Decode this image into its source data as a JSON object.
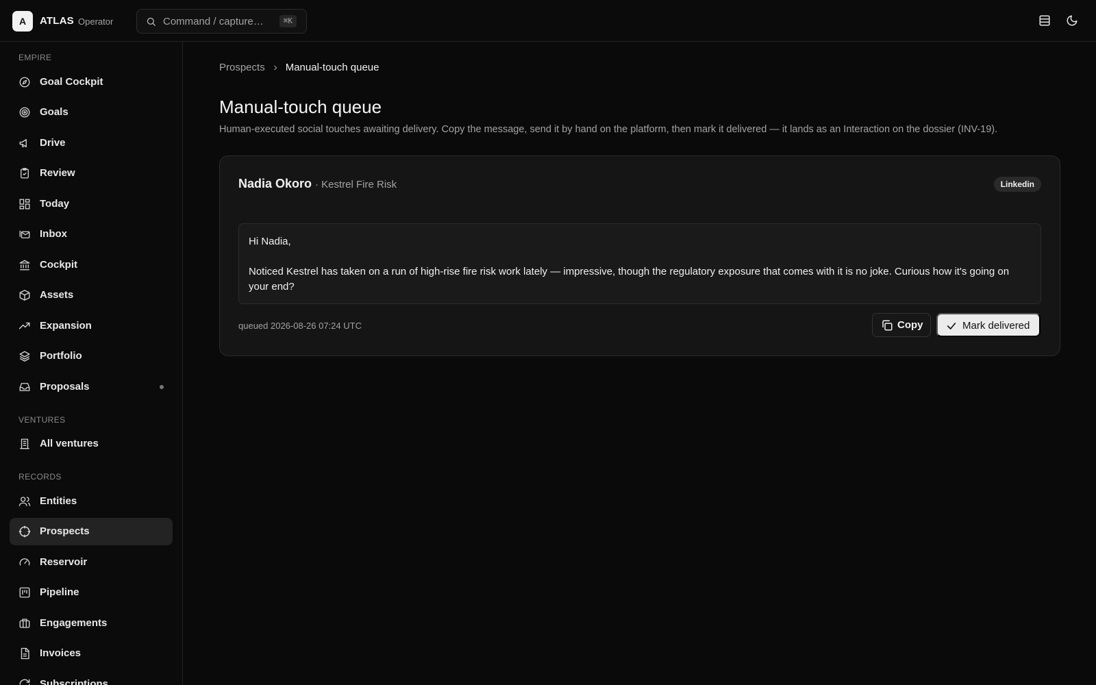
{
  "app": {
    "logo_letter": "A",
    "name": "ATLAS",
    "role": "Operator"
  },
  "search": {
    "placeholder": "Command / capture…",
    "shortcut": "⌘K"
  },
  "sidebar": {
    "sections": [
      {
        "label": "EMPIRE",
        "items": [
          {
            "label": "Goal Cockpit",
            "icon": "compass-icon"
          },
          {
            "label": "Goals",
            "icon": "target-icon"
          },
          {
            "label": "Drive",
            "icon": "megaphone-icon"
          },
          {
            "label": "Review",
            "icon": "clipboard-check-icon"
          },
          {
            "label": "Today",
            "icon": "dashboard-grid-icon"
          },
          {
            "label": "Inbox",
            "icon": "mail-stack-icon"
          },
          {
            "label": "Cockpit",
            "icon": "bank-icon"
          },
          {
            "label": "Assets",
            "icon": "cube-icon"
          },
          {
            "label": "Expansion",
            "icon": "trending-up-icon"
          },
          {
            "label": "Portfolio",
            "icon": "layers-icon"
          },
          {
            "label": "Proposals",
            "icon": "inbox-tray-icon"
          }
        ]
      },
      {
        "label": "VENTURES",
        "items": [
          {
            "label": "All ventures",
            "icon": "building-icon"
          }
        ]
      },
      {
        "label": "RECORDS",
        "items": [
          {
            "label": "Entities",
            "icon": "users-icon"
          },
          {
            "label": "Prospects",
            "icon": "crosshair-icon"
          },
          {
            "label": "Reservoir",
            "icon": "gauge-icon"
          },
          {
            "label": "Pipeline",
            "icon": "kanban-icon"
          },
          {
            "label": "Engagements",
            "icon": "briefcase-icon"
          },
          {
            "label": "Invoices",
            "icon": "file-text-icon"
          },
          {
            "label": "Subscriptions",
            "icon": "refresh-icon"
          }
        ]
      }
    ],
    "active_item": "Prospects"
  },
  "breadcrumb": {
    "parent": "Prospects",
    "current": "Manual-touch queue"
  },
  "page": {
    "title": "Manual-touch queue",
    "description": "Human-executed social touches awaiting delivery. Copy the message, send it by hand on the platform, then mark it delivered — it lands as an Interaction on the dossier (INV-19)."
  },
  "queue": [
    {
      "name": "Nadia Okoro",
      "company": "· Kestrel Fire Risk",
      "platform": "Linkedin",
      "message_lines": [
        "Hi Nadia,",
        "Noticed Kestrel has taken on a run of high-rise fire risk work lately — impressive, though the regulatory exposure that comes with it is no joke. Curious how it's going on your end?"
      ],
      "queued": "queued 2026-08-26 07:24 UTC",
      "copy_label": "Copy",
      "mark_label": "Mark delivered"
    }
  ]
}
